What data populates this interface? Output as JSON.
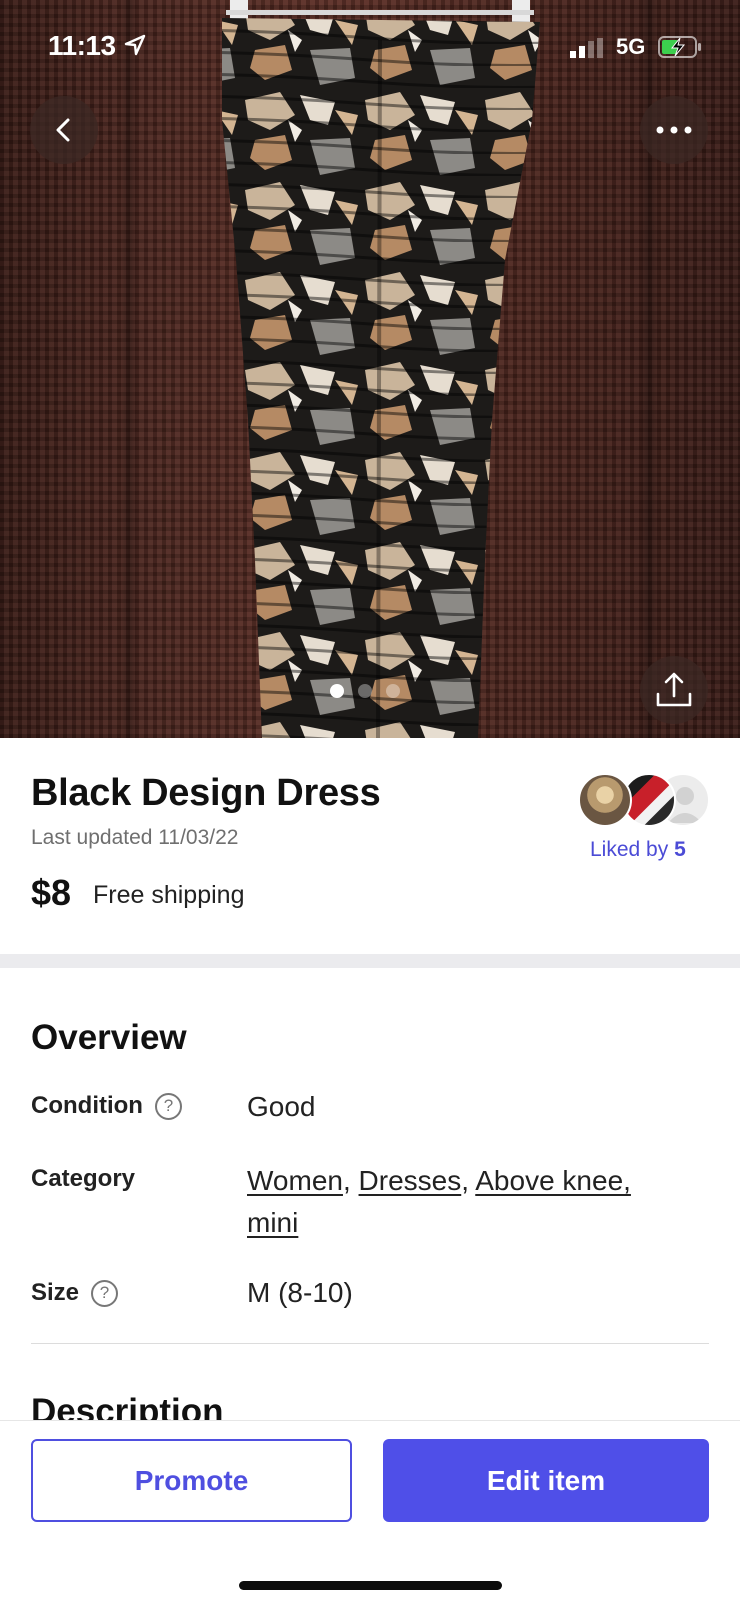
{
  "status_bar": {
    "time": "11:13",
    "network": "5G"
  },
  "gallery": {
    "image_count": 3,
    "active_index": 0,
    "icons": [
      "back-icon",
      "more-icon",
      "share-icon"
    ]
  },
  "listing": {
    "title": "Black Design Dress",
    "last_updated": "Last updated 11/03/22",
    "price": "$8",
    "shipping": "Free shipping"
  },
  "likes": {
    "prefix": "Liked by",
    "count": "5"
  },
  "overview": {
    "title": "Overview",
    "condition_label": "Condition",
    "condition_value": "Good",
    "category_label": "Category",
    "categories": [
      "Women",
      "Dresses",
      "Above knee, mini"
    ],
    "separator": ", ",
    "size_label": "Size",
    "size_value": "M (8-10)",
    "help_glyph": "?"
  },
  "description": {
    "title": "Description"
  },
  "actions": {
    "promote_label": "Promote",
    "edit_label": "Edit item"
  },
  "colors": {
    "accent": "#4f4fe8",
    "link": "#4b4bd6"
  }
}
